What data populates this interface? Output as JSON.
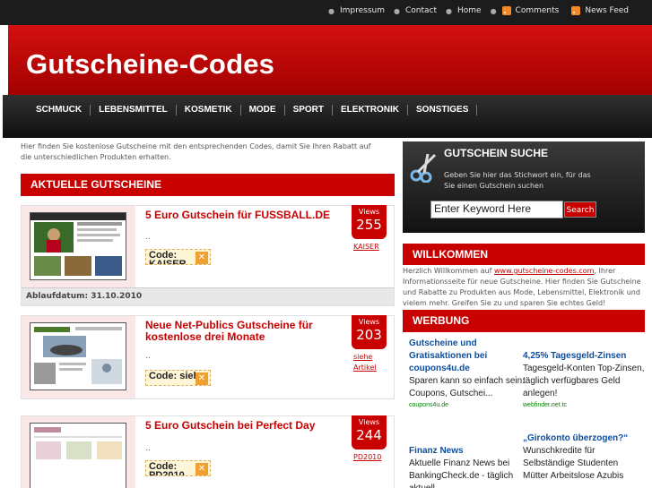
{
  "topnav": {
    "items": [
      "Impressum",
      "Contact",
      "Home"
    ],
    "comments": "Comments",
    "newsfeed": "News Feed"
  },
  "site": {
    "title": "Gutscheine-Codes"
  },
  "nav": {
    "items": [
      "SCHMUCK",
      "LEBENSMITTEL",
      "KOSMETIK",
      "MODE",
      "SPORT",
      "ELEKTRONIK",
      "SONSTIGES"
    ]
  },
  "intro": "Hier finden Sie kostenlose Gutscheine mit den entsprechenden Codes, damit Sie Ihren Rabatt auf die unterschiedlichen Produkten erhalten.",
  "main": {
    "heading": "AKTUELLE GUTSCHEINE"
  },
  "posts": [
    {
      "title": "5 Euro Gutschein für FUSSBALL.DE",
      "dots": "..",
      "code": "Code: KAISER",
      "views_label": "Views",
      "views": "255",
      "author": "KAISER",
      "expire": "Ablaufdatum: 31.10.2010"
    },
    {
      "title": "Neue Net-Publics Gutscheine für kostenlose drei Monate",
      "dots": "..",
      "code": "Code: siehe",
      "views_label": "Views",
      "views": "203",
      "author": "siehe Artikel"
    },
    {
      "title": "5 Euro Gutschein bei Perfect Day",
      "dots": "..",
      "code": "Code: PD2010",
      "views_label": "Views",
      "views": "244",
      "author": "PD2010"
    }
  ],
  "search": {
    "heading": "GUTSCHEIN SUCHE",
    "desc": "Geben Sie hier das Stichwort ein, für das Sie einen Gutschein suchen",
    "value": "Enter Keyword Here",
    "button": "Search"
  },
  "welcome": {
    "heading": "WILLKOMMEN",
    "pre": "Herzlich Willkommen auf ",
    "link": "www.gutscheine-codes.com",
    "post": ", Ihrer Informationsseite für neue Gutscheine. Hier finden Sie Gutscheine und Rabatte zu Produkten aus Mode, Lebensmittel, Elektronik und vielem mehr. Greifen Sie zu und sparen Sie echtes Geld!"
  },
  "ads": {
    "heading": "WERBUNG",
    "items": [
      {
        "title": "Gutscheine und Gratisaktionen bei coupons4u.de",
        "body": "Sparen kann so einfach sein: Coupons, Gutschei...",
        "url": "coupons4u.de"
      },
      {
        "title": "4,25% Tagesgeld-Zinsen",
        "body": "Tagesgeld-Konten Top-Zinsen, täglich verfügbares Geld anlegen!",
        "url": "webfinder.net.tc"
      },
      {
        "title": "Finanz News",
        "body": "Aktuelle Finanz News bei BankingCheck.de - täglich aktuell",
        "url": ""
      },
      {
        "title": "„Girokonto überzogen?“",
        "body": "Wunschkredite für Selbständige Studenten Mütter Arbeitslose Azubis",
        "url": ""
      }
    ]
  },
  "colors": {
    "accent": "#c80000",
    "dark": "#1c1c1c",
    "link": "#0b4e9e",
    "adurl": "#008000"
  }
}
